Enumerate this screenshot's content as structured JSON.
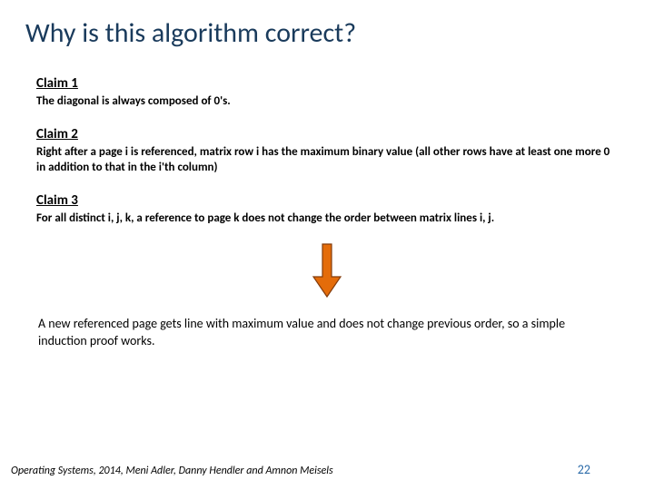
{
  "title": "Why is this algorithm correct?",
  "claims": [
    {
      "head": "Claim 1",
      "body": "The diagonal is always composed of 0's."
    },
    {
      "head": "Claim 2",
      "body": "Right after a page i is referenced,  matrix row i has the maximum binary value (all other rows have at least one more 0 in addition to that in the i'th column)"
    },
    {
      "head": "Claim 3",
      "body": "For all distinct i, j, k, a reference to page k does not change the order between matrix lines i, j."
    }
  ],
  "summary": "A new referenced page gets line with maximum value and does not change previous order, so a simple induction proof works.",
  "footer_left": "Operating Systems, 2014, Meni Adler, Danny Hendler and Amnon Meisels",
  "page_number": "22",
  "arrow_color": "#e46c0a",
  "arrow_stroke": "#843c0c"
}
